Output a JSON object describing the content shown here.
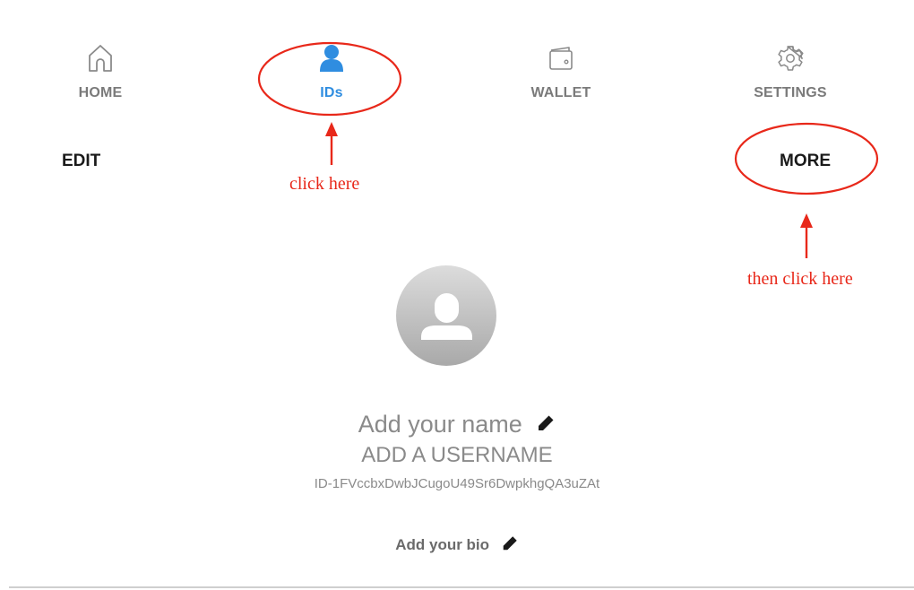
{
  "nav": {
    "items": [
      {
        "label": "HOME",
        "icon": "home-icon",
        "active": false
      },
      {
        "label": "IDs",
        "icon": "user-icon",
        "active": true
      },
      {
        "label": "WALLET",
        "icon": "wallet-icon",
        "active": false
      },
      {
        "label": "SETTINGS",
        "icon": "gear-icon",
        "active": false
      }
    ]
  },
  "actions": {
    "edit_label": "EDIT",
    "more_label": "MORE"
  },
  "annotations": {
    "first": "click here",
    "second": "then click here",
    "color": "#e8281a"
  },
  "profile": {
    "avatar_icon": "user-icon",
    "name_placeholder": "Add your name",
    "username_placeholder": "ADD A USERNAME",
    "id": "ID-1FVccbxDwbJCugoU49Sr6DwpkhgQA3uZAt",
    "bio_placeholder": "Add your bio"
  },
  "colors": {
    "active_nav": "#2f8de0",
    "inactive_nav": "#7a7a7a",
    "annotation": "#e8281a"
  }
}
